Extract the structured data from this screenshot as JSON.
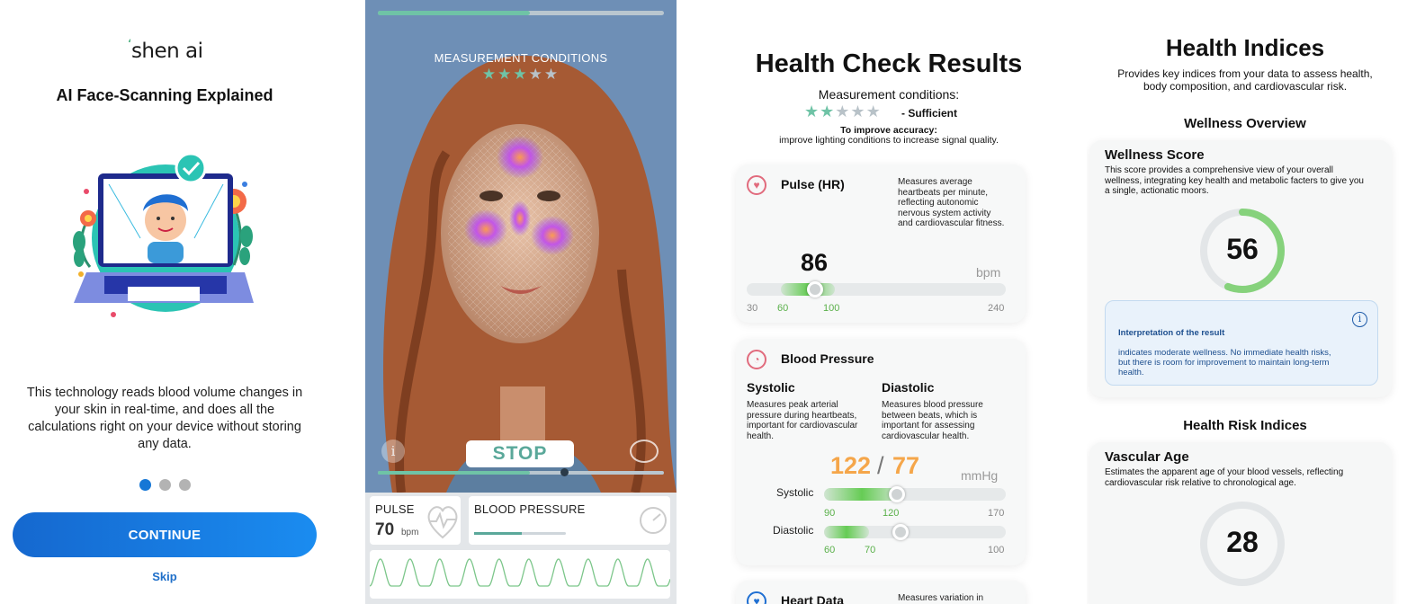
{
  "panel1": {
    "logo": "shen ai",
    "title": "AI Face-Scanning Explained",
    "body": "This technology reads blood volume changes in your skin in real-time, and does all the calculations right on your device without storing any data.",
    "continue_label": "CONTINUE",
    "skip_label": "Skip",
    "page_dots": {
      "count": 3,
      "active": 0
    }
  },
  "panel2": {
    "measurement_conditions_label": "MEASUREMENT CONDITIONS",
    "stars": {
      "filled": 3,
      "total": 5
    },
    "progress_top": 0.53,
    "progress_bottom": 0.53,
    "stop_label": "STOP",
    "info_icon": "i",
    "pulse_label": "PULSE",
    "pulse_value": "70",
    "pulse_unit": "bpm",
    "bp_label": "BLOOD PRESSURE",
    "bp_progress": 0.52
  },
  "panel3": {
    "title": "Health Check Results",
    "measurement_conditions": "Measurement conditions:",
    "stars": {
      "filled": 2,
      "total": 5
    },
    "sufficient": "- Sufficient",
    "improve_title": "To improve accuracy:",
    "improve_text": "improve lighting conditions to increase signal quality.",
    "pulse": {
      "name": "Pulse (HR)",
      "desc": "Measures average heartbeats per minute, reflecting autonomic nervous system activity and cardiovascular fitness.",
      "value": "86",
      "unit": "bpm",
      "ticks": [
        "30",
        "60",
        "100",
        "240"
      ]
    },
    "bp": {
      "name": "Blood Pressure",
      "systolic_head": "Systolic",
      "systolic_desc": "Measures peak arterial pressure during heartbeats, important for cardiovascular health.",
      "diastolic_head": "Diastolic",
      "diastolic_desc": "Measures blood pressure between beats, which is important for assessing cardiovascular health.",
      "value_sys": "122",
      "slash": "/",
      "value_dia": "77",
      "unit": "mmHg",
      "systolic_label": "Systolic",
      "systolic_ticks": [
        "90",
        "120",
        "170"
      ],
      "diastolic_label": "Diastolic",
      "diastolic_ticks": [
        "60",
        "70",
        "100"
      ]
    },
    "heart_data": {
      "name": "Heart Data",
      "desc": "Measures variation in"
    }
  },
  "panel4": {
    "title": "Health Indices",
    "subtitle": "Provides key indices from your data to assess health, body composition, and cardiovascular risk.",
    "wellness_overview": "Wellness Overview",
    "wellness": {
      "name": "Wellness Score",
      "desc": "This score provides a comprehensive view of your overall wellness, integrating key health and metabolic facters to give you a single, actionatic moors.",
      "score": "56",
      "score_fraction": 0.56,
      "interp_title": "Interpretation of the result",
      "interp_text": "indicates moderate wellness. No immediate health risks, but there is room for improvement to maintain long-term health."
    },
    "risk_title": "Health Risk Indices",
    "vascular": {
      "name": "Vascular Age",
      "desc": "Estimates the apparent age of your blood vessels, reflecting cardiovascular risk relative to chronological age.",
      "value": "28"
    }
  },
  "colors": {
    "accent_blue": "#1677d6",
    "teal": "#6fc3a6",
    "orange": "#f5a64a",
    "green": "#66cc55"
  }
}
